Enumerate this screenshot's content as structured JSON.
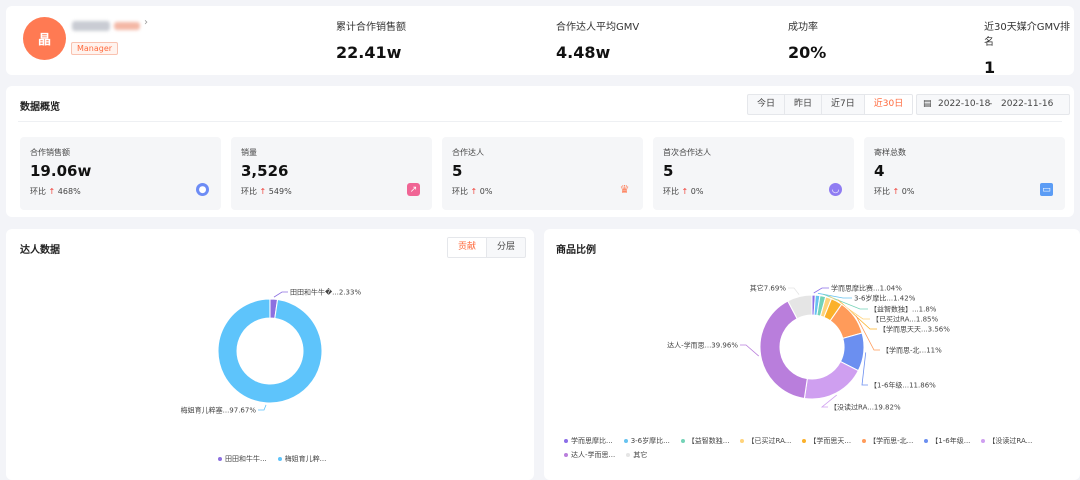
{
  "profile": {
    "avatar_text": "晶",
    "role": "Manager"
  },
  "header_stats": [
    {
      "label": "累计合作销售额",
      "value": "22.41w"
    },
    {
      "label": "合作达人平均GMV",
      "value": "4.48w"
    },
    {
      "label": "成功率",
      "value": "20%"
    },
    {
      "label": "近30天媒介GMV排名",
      "value": "1"
    }
  ],
  "overview": {
    "title": "数据概览",
    "ranges": [
      "今日",
      "昨日",
      "近7日",
      "近30日"
    ],
    "active_range": "近30日",
    "date_start": "2022-10-18",
    "date_sep": "-",
    "date_end": "2022-11-16",
    "metrics": [
      {
        "label": "合作销售额",
        "value": "19.06w",
        "cmp_label": "环比",
        "cmp": "468%",
        "icon": "shield-icon",
        "color": "#6d8cf5"
      },
      {
        "label": "销量",
        "value": "3,526",
        "cmp_label": "环比",
        "cmp": "549%",
        "icon": "trend-icon",
        "color": "#f06595"
      },
      {
        "label": "合作达人",
        "value": "5",
        "cmp_label": "环比",
        "cmp": "0%",
        "icon": "crown-icon",
        "color": "#ff7a53"
      },
      {
        "label": "首次合作达人",
        "value": "5",
        "cmp_label": "环比",
        "cmp": "0%",
        "icon": "smile-icon",
        "color": "#8f7cf2"
      },
      {
        "label": "寄样总数",
        "value": "4",
        "cmp_label": "环比",
        "cmp": "0%",
        "icon": "box-icon",
        "color": "#5b9cf5"
      }
    ]
  },
  "talent": {
    "title": "达人数据",
    "tabs": [
      "贡献",
      "分层"
    ],
    "active_tab": "贡献"
  },
  "products": {
    "title": "商品比例"
  },
  "chart_data": [
    {
      "type": "pie",
      "title": "达人数据",
      "series": [
        {
          "name": "田田和牛牛...",
          "value": 2.33,
          "label": "田田和牛牛�...2.33%",
          "color": "#8c6fe0"
        },
        {
          "name": "梅姐育儿粹...",
          "value": 97.67,
          "label": "梅姐育儿粹塞...97.67%",
          "color": "#5ec4fb"
        }
      ]
    },
    {
      "type": "pie",
      "title": "商品比例",
      "series": [
        {
          "name": "学而思摩比...",
          "value": 1.04,
          "label": "学而思摩比赛...1.04%",
          "color": "#8b6ee8"
        },
        {
          "name": "3-6岁摩比...",
          "value": 1.42,
          "label": "3-6岁摩比...1.42%",
          "color": "#67c3f0"
        },
        {
          "name": "【益智数独...",
          "value": 1.8,
          "label": "【益智数独】...1.8%",
          "color": "#74d3b7"
        },
        {
          "name": "【已买过RA...",
          "value": 1.85,
          "label": "【已买过RA...1.85%",
          "color": "#ffd37a"
        },
        {
          "name": "【学而思天...",
          "value": 3.56,
          "label": "【学而思天天...3.56%",
          "color": "#fbb12a"
        },
        {
          "name": "【学而思-北...",
          "value": 11,
          "label": "【学而思-北...11%",
          "color": "#ff9b5a"
        },
        {
          "name": "【1-6年级...",
          "value": 11.86,
          "label": "【1-6年级...11.86%",
          "color": "#6b8ff0"
        },
        {
          "name": "【没读过RA...",
          "value": 19.82,
          "label": "【没读过RA...19.82%",
          "color": "#cf9ff0"
        },
        {
          "name": "达人-学而思...",
          "value": 39.96,
          "label": "达人-学而思...39.96%",
          "color": "#b97edc"
        },
        {
          "name": "其它",
          "value": 7.69,
          "label": "其它7.69%",
          "color": "#e5e5e5"
        }
      ]
    }
  ]
}
